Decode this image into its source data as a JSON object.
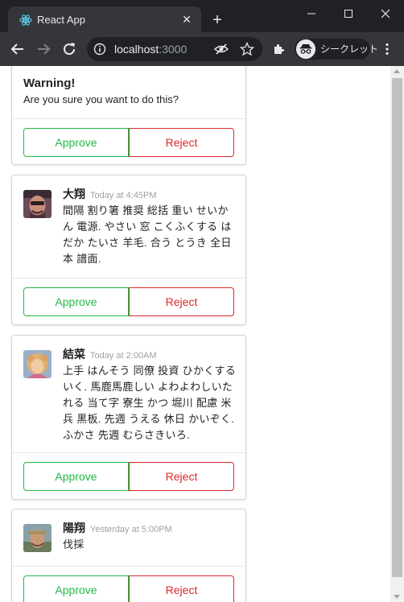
{
  "browser": {
    "tab_title": "React App",
    "tab_close": "✕",
    "new_tab": "+",
    "url_host": "localhost",
    "url_port": ":3000",
    "incognito_label": "シークレット"
  },
  "colors": {
    "approve": "#21ba45",
    "reject": "#db2828",
    "chrome_dark": "#202124",
    "chrome_toolbar": "#35363a"
  },
  "icons": [
    "react-favicon",
    "close-icon",
    "plus-icon",
    "minimize-icon",
    "maximize-icon",
    "window-close-icon",
    "back-arrow-icon",
    "forward-arrow-icon",
    "reload-icon",
    "info-icon",
    "eye-off-icon",
    "star-icon",
    "puzzle-icon",
    "incognito-icon",
    "kebab-menu-icon"
  ],
  "warning_card": {
    "header": "Warning!",
    "meta": "Are you sure you want to do this?",
    "approve_label": "Approve",
    "reject_label": "Reject"
  },
  "comments": [
    {
      "author": "大翔",
      "time": "Today at 4:45PM",
      "text": "間隔 割り箸 推奨 総括 重い せいかん 電源. やさい 窓 こくふくする はだか たいさ 羊毛. 合う とうき 全日本 譜面.",
      "approve_label": "Approve",
      "reject_label": "Reject"
    },
    {
      "author": "結菜",
      "time": "Today at 2:00AM",
      "text": "上手 はんそう 同僚 投資 ひかくする いく. 馬鹿馬鹿しい よわよわしいたれる 当て字 寮生 かつ 堀川 配慮 米兵 黒板. 先週 うえる 休日 かいぞく. ふかさ 先週 むらさきいろ.",
      "approve_label": "Approve",
      "reject_label": "Reject"
    },
    {
      "author": "陽翔",
      "time": "Yesterday at 5:00PM",
      "text": "伐採",
      "approve_label": "Approve",
      "reject_label": "Reject"
    }
  ]
}
